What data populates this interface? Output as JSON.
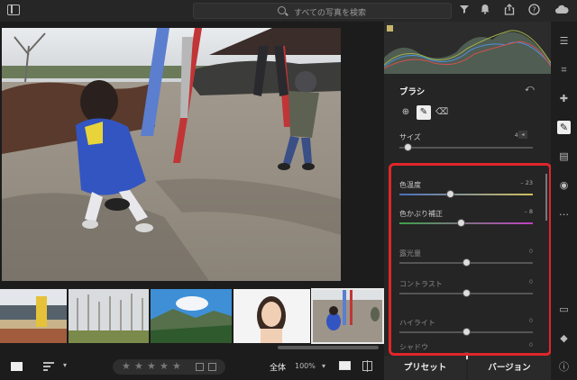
{
  "search": {
    "placeholder": "すべての写真を検索"
  },
  "icons": {
    "panel_toggle": "panel-toggle-icon",
    "filter": "filter-icon",
    "notifications": "bell-icon",
    "share": "share-icon",
    "help": "help-icon",
    "cloud": "cloud-icon"
  },
  "brush_panel": {
    "title": "ブラシ",
    "tools": [
      "add-brush-icon",
      "brush-icon",
      "eraser-icon"
    ],
    "size": {
      "label": "サイズ",
      "value": "4.0"
    },
    "sliders": [
      {
        "label": "色温度",
        "value": "– 23",
        "level": 0.38
      },
      {
        "label": "色かぶり補正",
        "value": "– 8",
        "level": 0.46
      },
      {
        "label": "露光量",
        "value": "0",
        "level": 0.5
      },
      {
        "label": "コントラスト",
        "value": "0",
        "level": 0.5
      },
      {
        "label": "ハイライト",
        "value": "0",
        "level": 0.5
      },
      {
        "label": "シャドウ",
        "value": "0",
        "level": 0.5
      }
    ],
    "footer": {
      "preset": "プリセット",
      "version": "バージョン"
    }
  },
  "bottom_toolbar": {
    "zen_label": "全体",
    "zoom": "100%",
    "stars": [
      "★",
      "★",
      "★",
      "★",
      "★"
    ]
  },
  "accent": {
    "highlight_box": "#e0262b"
  }
}
